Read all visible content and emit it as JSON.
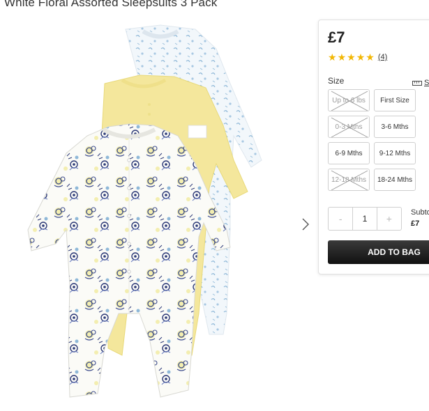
{
  "product": {
    "title": "White Floral Assorted Sleepsuits 3 Pack",
    "image_icon": "sleepsuits-photo"
  },
  "purchase": {
    "price": "£7",
    "rating": 5,
    "review_count": "(4)",
    "size_label": "Size",
    "size_guide_label": "S",
    "sizes": [
      {
        "label": "Up to 6 lbs",
        "available": false
      },
      {
        "label": "First Size",
        "available": true
      },
      {
        "label": "0-3 Mths",
        "available": false
      },
      {
        "label": "3-6 Mths",
        "available": true
      },
      {
        "label": "6-9 Mths",
        "available": true
      },
      {
        "label": "9-12 Mths",
        "available": true
      },
      {
        "label": "12-18 Mths",
        "available": false
      },
      {
        "label": "18-24 Mths",
        "available": true
      }
    ],
    "quantity": {
      "minus": "-",
      "value": "1",
      "plus": "+"
    },
    "subtotal_label": "Subto",
    "subtotal_value": "£7",
    "add_to_bag_label": "ADD TO BAG"
  },
  "colors": {
    "star": "#f2b705",
    "button_dark": "#111111",
    "yellow_suit": "#f4e79c",
    "print_navy": "#3b4a8a"
  }
}
